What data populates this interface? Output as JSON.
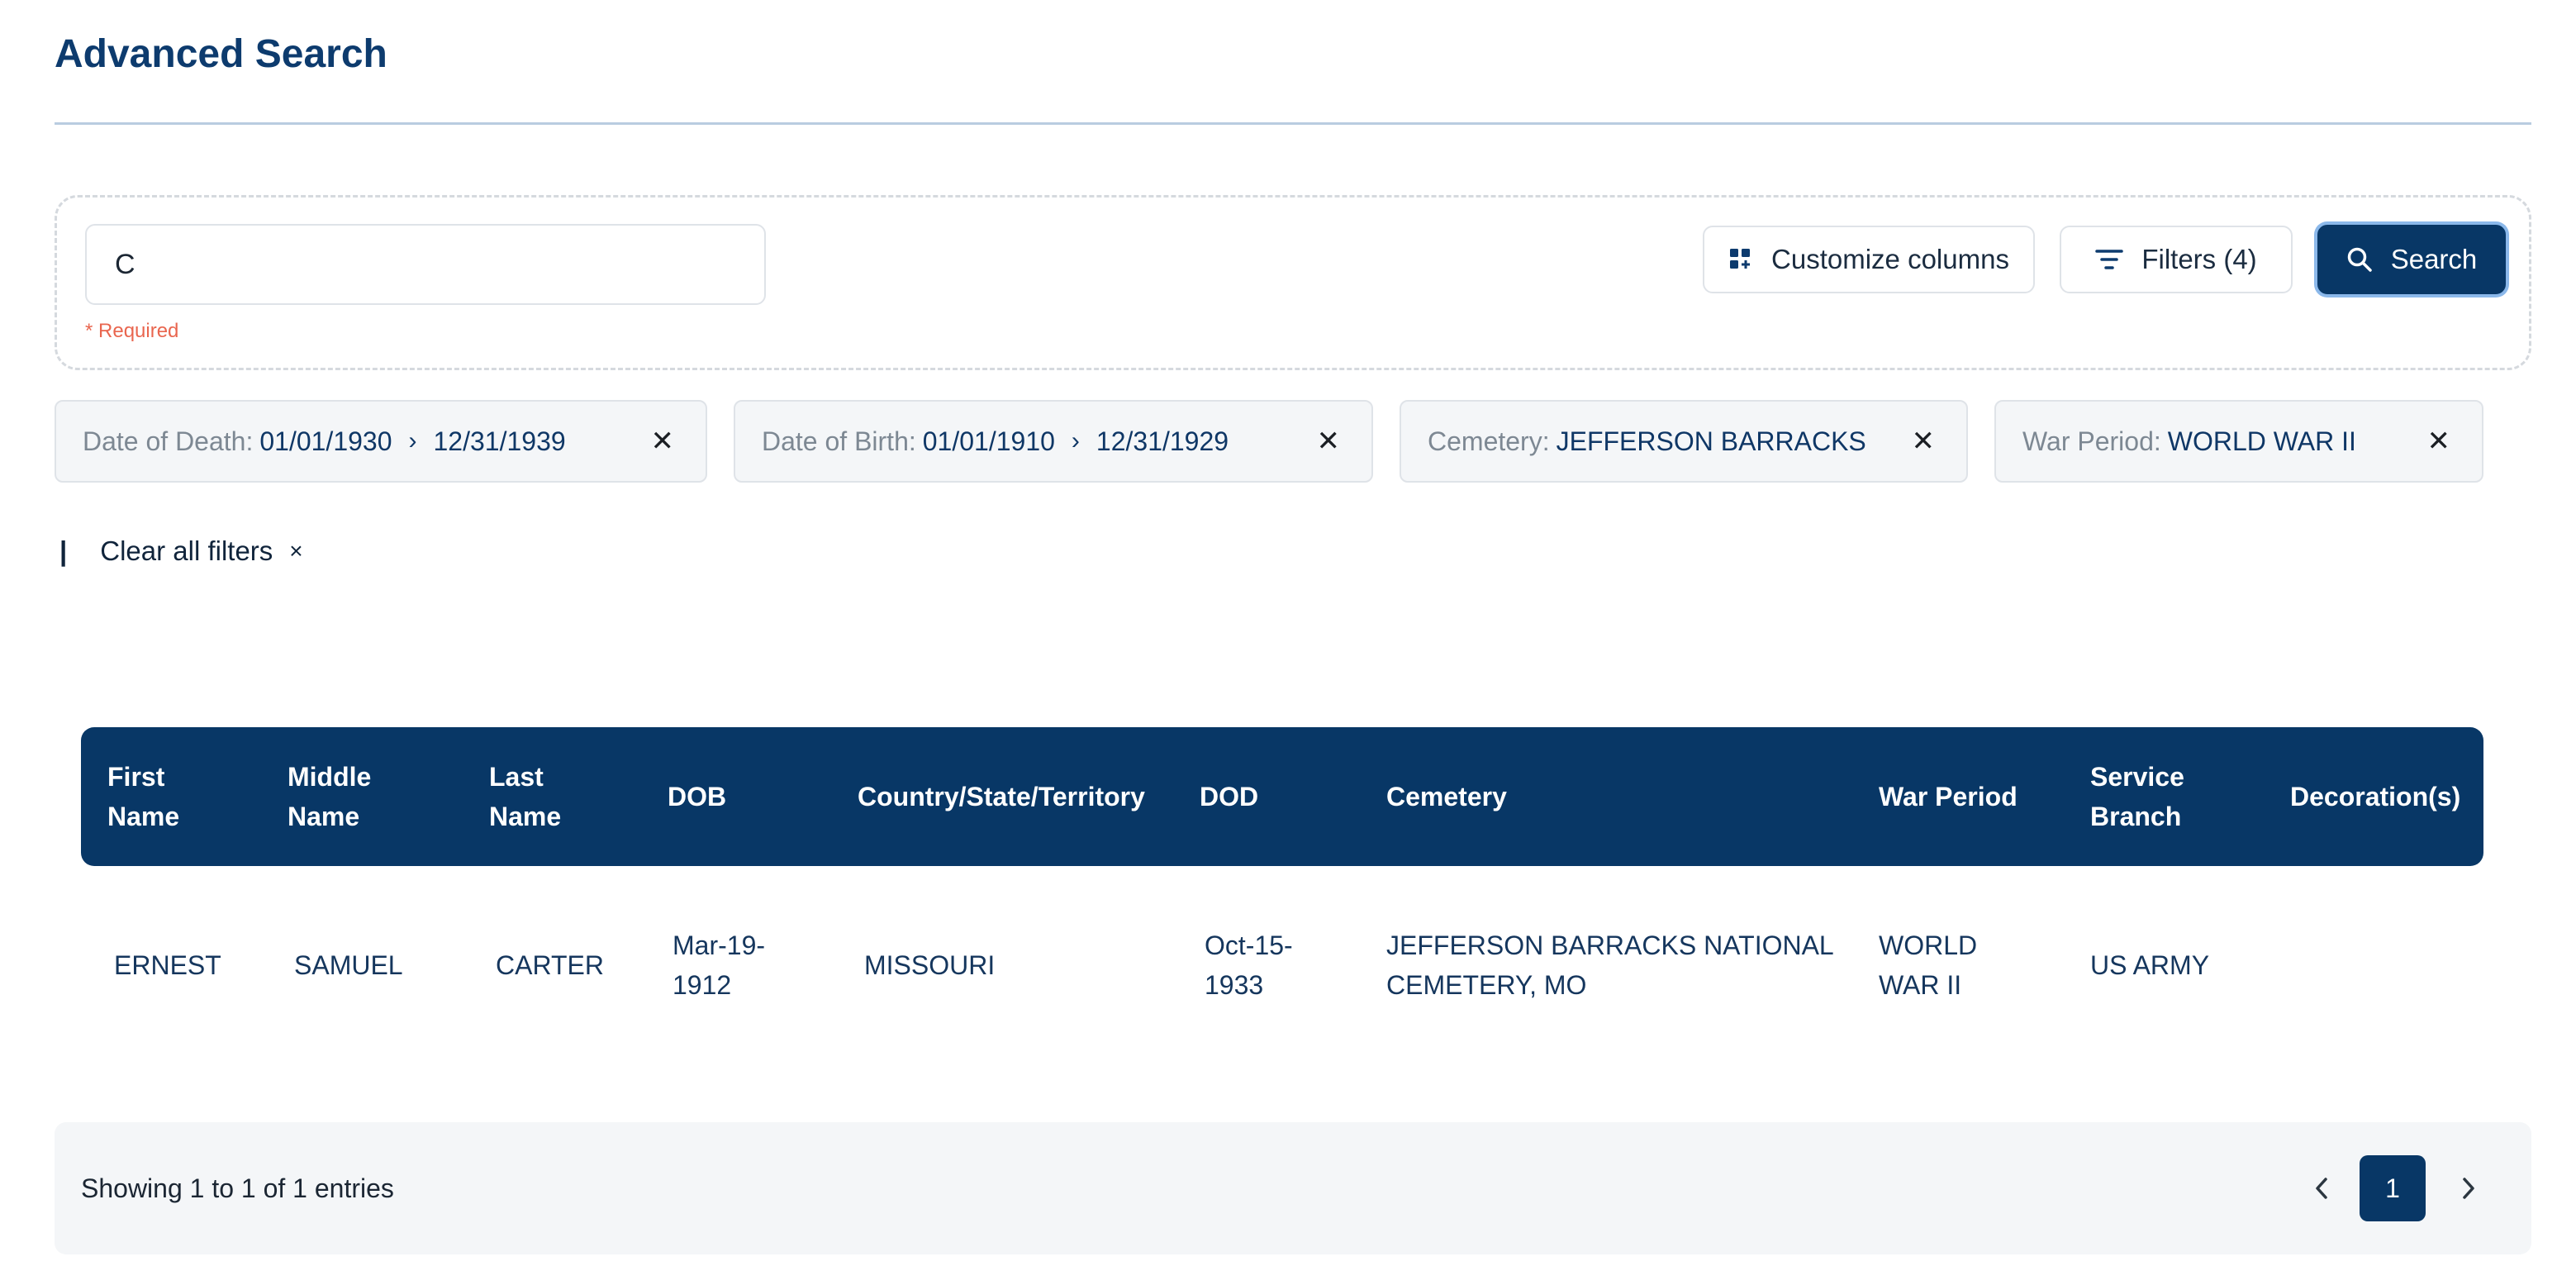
{
  "page": {
    "title": "Advanced Search"
  },
  "search": {
    "query_value": "C",
    "required_note": "* Required",
    "customize_label": "Customize columns",
    "filters_label": "Filters (4)",
    "search_label": "Search"
  },
  "chips": [
    {
      "key": "Date of Death:",
      "from": "01/01/1930",
      "to": "12/31/1939"
    },
    {
      "key": "Date of Birth:",
      "from": "01/01/1910",
      "to": "12/31/1929"
    },
    {
      "key": "Cemetery:",
      "value": "JEFFERSON BARRACKS"
    },
    {
      "key": "War Period:",
      "value": "WORLD WAR II"
    }
  ],
  "clear": {
    "bar": "|",
    "label": "Clear all filters",
    "close": "×"
  },
  "table": {
    "headers": {
      "first_name": "First Name",
      "middle_name": "Middle Name",
      "last_name": "Last Name",
      "dob": "DOB",
      "country": "Country/State/Territory",
      "dod": "DOD",
      "cemetery": "Cemetery",
      "war_period": "War Period",
      "service_branch": "Service Branch",
      "decorations": "Decoration(s)"
    },
    "rows": [
      {
        "first_name": "ERNEST",
        "middle_name": "SAMUEL",
        "last_name": "CARTER",
        "dob": "Mar-19-1912",
        "country": "MISSOURI",
        "dod": "Oct-15-1933",
        "cemetery": "JEFFERSON BARRACKS NATIONAL CEMETERY, MO",
        "war_period": "WORLD WAR II",
        "service_branch": "US ARMY",
        "decorations": ""
      }
    ]
  },
  "pagination": {
    "summary": "Showing 1 to 1 of 1 entries",
    "current_page": "1"
  },
  "icons": {
    "customize": "grid-plus-icon",
    "filters": "filter-lines-icon",
    "search": "search-icon",
    "chip_separator": "chevron-right-icon",
    "chip_remove": "close-icon",
    "prev": "chevron-left-icon",
    "next": "chevron-right-icon"
  },
  "colors": {
    "brand": "#083766",
    "required": "#e9664f",
    "chip_bg": "#f4f6f8"
  }
}
